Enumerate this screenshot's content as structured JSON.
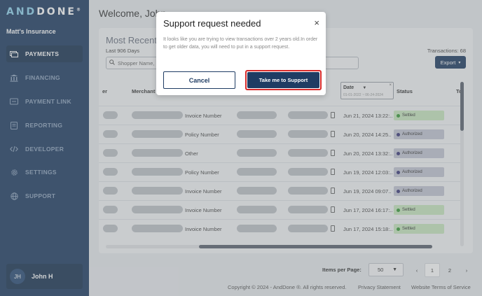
{
  "brand": {
    "logo_and": "AND",
    "logo_done": "DONE",
    "logo_mark": "®"
  },
  "sidebar": {
    "org_name": "Matt's Insurance",
    "items": [
      {
        "label": "PAYMENTS",
        "icon": "payments-icon"
      },
      {
        "label": "FINANCING",
        "icon": "bank-icon"
      },
      {
        "label": "PAYMENT LINK",
        "icon": "link-icon"
      },
      {
        "label": "REPORTING",
        "icon": "report-icon"
      },
      {
        "label": "DEVELOPER",
        "icon": "code-icon"
      },
      {
        "label": "SETTINGS",
        "icon": "gear-icon"
      },
      {
        "label": "SUPPORT",
        "icon": "globe-icon"
      }
    ],
    "user": {
      "initials": "JH",
      "name": "John H"
    }
  },
  "header": {
    "welcome": "Welcome, John"
  },
  "panel": {
    "title": "Most Recent",
    "subtitle": "Last 906 Days",
    "search_placeholder": "Shopper Name,",
    "transactions": "Transactions: 68",
    "export_label": "Export"
  },
  "table": {
    "columns": {
      "c0": "er",
      "merchant": "Merchant",
      "date": "Date",
      "status": "Status",
      "total": "To"
    },
    "date_filter": {
      "range": "01-01-2022 ~ 06-24-2024",
      "clear": "×"
    },
    "rows": [
      {
        "type": "Invoice Number",
        "date": "Jun 21, 2024 13:22:..",
        "status": "Settled"
      },
      {
        "type": "Policy Number",
        "date": "Jun 20, 2024 14:25..",
        "status": "Authorized"
      },
      {
        "type": "Other",
        "date": "Jun 20, 2024 13:32:..",
        "status": "Authorized"
      },
      {
        "type": "Policy Number",
        "date": "Jun 19, 2024 12:03:..",
        "status": "Authorized"
      },
      {
        "type": "Invoice Number",
        "date": "Jun 19, 2024 09:07..",
        "status": "Authorized"
      },
      {
        "type": "Invoice Number",
        "date": "Jun 17, 2024 16:17:..",
        "status": "Settled"
      },
      {
        "type": "Invoice Number",
        "date": "Jun 17, 2024 15:18:..",
        "status": "Settled"
      }
    ]
  },
  "pagination": {
    "items_per_page_label": "Items per Page:",
    "per_page": "50",
    "prev": "‹",
    "pages": [
      "1",
      "2"
    ],
    "next": "›"
  },
  "footer": {
    "copyright": "Copyright © 2024 - AndDone ®. All rights reserved.",
    "privacy": "Privacy Statement",
    "terms": "Website Terms of Service"
  },
  "modal": {
    "title": "Support request needed",
    "body": "It looks like you are trying to view transactions over 2 years old.In order to get older data, you will need to put in a support request.",
    "cancel_label": "Cancel",
    "support_label": "Take me to Support",
    "close": "×"
  },
  "colors": {
    "sidebar": "#1f3c63",
    "settled": "#c9e8c0",
    "authorized": "#c4c6d4",
    "highlight": "#d72a2a"
  }
}
